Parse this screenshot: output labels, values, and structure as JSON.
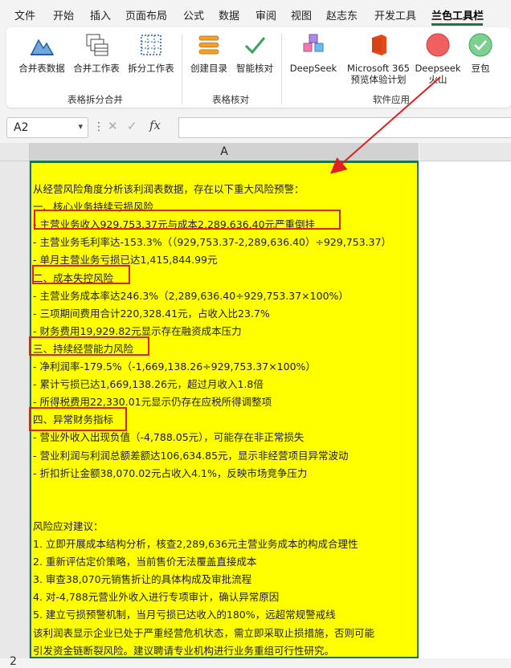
{
  "menu": {
    "items": [
      "文件",
      "开始",
      "插入",
      "页面布局",
      "公式",
      "数据",
      "审阅",
      "视图",
      "赵志东",
      "开发工具",
      "兰色工具栏"
    ],
    "active": "兰色工具栏"
  },
  "ribbon": {
    "groups": [
      {
        "label": "表格拆分合并",
        "buttons": [
          "合并表数据",
          "合并工作表",
          "拆分工作表"
        ]
      },
      {
        "label": "表格核对",
        "buttons": [
          "创建目录",
          "智能核对"
        ]
      },
      {
        "label": "软件应用",
        "buttons": [
          "DeepSeek",
          "Microsoft 365 预览体验计划",
          "Deepseek 火山",
          "豆包"
        ]
      }
    ]
  },
  "formula_bar": {
    "name_box": "A2",
    "fx": "fx",
    "value": ""
  },
  "sheet": {
    "column": "A",
    "row": "2",
    "cell_lines": [
      "从经营风险角度分析该利润表数据，存在以下重大风险预警：",
      "一、核心业务持续亏损风险",
      "- 主营业务收入929,753.37元与成本2,289,636.40元严重倒挂",
      "- 主营业务毛利率达-153.3%（（929,753.37-2,289,636.40）÷929,753.37）",
      "- 单月主营业务亏损已达1,415,844.99元",
      "二、成本失控风险",
      "- 主营业务成本率达246.3%（2,289,636.40÷929,753.37×100%）",
      "- 三项期间费用合计220,328.41元，占收入比23.7%",
      "- 财务费用19,929.82元显示存在融资成本压力",
      "三、持续经营能力风险",
      "- 净利润率-179.5%（-1,669,138.26÷929,753.37×100%）",
      "- 累计亏损已达1,669,138.26元，超过月收入1.8倍",
      "- 所得税费用22,330.01元显示仍存在应税所得调整项",
      "四、异常财务指标",
      "- 营业外收入出现负值（-4,788.05元），可能存在非正常损失",
      "- 营业利润与利润总额差额达106,634.85元，显示非经营项目异常波动",
      "- 折扣折让金额38,070.02元占收入4.1%，反映市场竞争压力",
      "",
      "",
      "风险应对建议：",
      "1. 立即开展成本结构分析，核查2,289,636元主营业务成本的构成合理性",
      "2. 重新评估定价策略，当前售价无法覆盖直接成本",
      "3. 审查38,070元销售折让的具体构成及审批流程",
      "4. 对-4,788元营业外收入进行专项审计，确认异常原因",
      "5. 建立亏损预警机制，当月亏损已达收入的180%，远超常规警戒线",
      "该利润表显示企业已处于严重经营危机状态，需立即采取止损措施，否则可能",
      "引发资金链断裂风险。建议聘请专业机构进行业务重组可行性研究。"
    ]
  },
  "colors": {
    "cell_fill": "#ffff00",
    "highlight_box": "#e02020",
    "selection": "#217346"
  }
}
